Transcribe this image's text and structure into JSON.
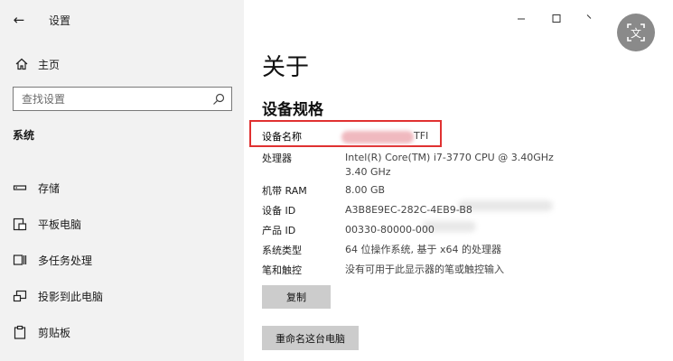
{
  "window": {
    "title": "设置",
    "back_label": "←",
    "minimize": "–",
    "maximize": "□",
    "close": "×"
  },
  "sidebar": {
    "home_label": "主页",
    "search_placeholder": "查找设置",
    "section_title": "系统",
    "items": [
      {
        "label": "存储",
        "icon": "storage-icon"
      },
      {
        "label": "平板电脑",
        "icon": "tablet-icon"
      },
      {
        "label": "多任务处理",
        "icon": "multitasking-icon"
      },
      {
        "label": "投影到此电脑",
        "icon": "projecting-icon"
      },
      {
        "label": "剪贴板",
        "icon": "clipboard-icon"
      }
    ]
  },
  "main": {
    "title": "关于",
    "subtitle": "设备规格",
    "specs": [
      {
        "label": "设备名称",
        "value": "TFI"
      },
      {
        "label": "处理器",
        "value": "Intel(R) Core(TM) i7-3770 CPU @ 3.40GHz   3.40 GHz"
      },
      {
        "label": "机带 RAM",
        "value": "8.00 GB"
      },
      {
        "label": "设备 ID",
        "value": "A3B8E9EC-282C-4EB9-B8"
      },
      {
        "label": "产品 ID",
        "value": "00330-80000-000"
      },
      {
        "label": "系统类型",
        "value": "64 位操作系统, 基于 x64 的处理器"
      },
      {
        "label": "笔和触控",
        "value": "没有可用于此显示器的笔或触控输入"
      }
    ],
    "copy_button": "复制",
    "rename_button": "重命名这台电脑"
  },
  "overlay": {
    "translate_icon": "translate-icon",
    "translate_glyph": "文"
  },
  "colors": {
    "highlight": "#e03131",
    "button_bg": "#cccccc",
    "sidebar_bg": "#f2f2f2"
  }
}
